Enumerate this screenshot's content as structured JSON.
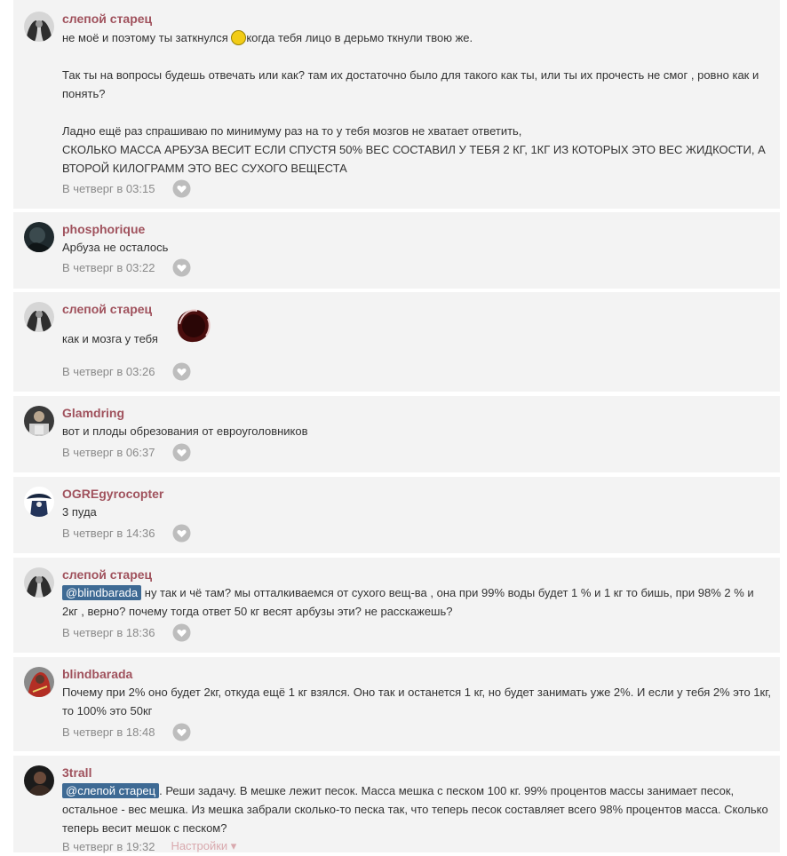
{
  "comments": [
    {
      "author": "слепой старец",
      "lines": [
        "не моё и поэтому ты заткнулся ",
        "когда тебя лицо в дерьмо ткнули твою же.",
        "Так ты на вопросы будешь отвечать или как? там их достаточно было для такого как ты, или ты их прочесть не смог , ровно как и понять?",
        "Ладно ещё раз спрашиваю по минимуму раз на то у тебя мозгов не хватает ответить,",
        "СКОЛЬКО МАССА АРБУЗА ВЕСИТ ЕСЛИ СПУСТЯ 50% ВЕС СОСТАВИЛ У ТЕБЯ 2 КГ, 1КГ ИЗ КОТОРЫХ ЭТО ВЕС ЖИДКОСТИ, А ВТОРОЙ КИЛОГРАММ ЭТО ВЕС СУХОГО ВЕЩЕСТА"
      ],
      "time": "В четверг в 03:15"
    },
    {
      "author": "phosphorique",
      "text": "Арбуза не осталось",
      "time": "В четверг в 03:22"
    },
    {
      "author": "слепой старец",
      "text": "как и мозга у тебя",
      "time": "В четверг в 03:26"
    },
    {
      "author": "Glamdring",
      "text": "вот и плоды обрезования от евроуголовников",
      "time": "В четверг в 06:37"
    },
    {
      "author": "OGREgyrocopter",
      "text": "3 пуда",
      "time": "В четверг в 14:36"
    },
    {
      "author": "слепой старец",
      "mention": "@blindbarada",
      "text": " ну так и чё там? мы отталкиваемся от сухого вещ-ва , она при 99% воды будет 1 % и 1 кг то бишь, при 98%  2 % и 2кг , верно? почему тогда ответ 50 кг весят арбузы эти? не расскажешь?",
      "time": "В четверг в 18:36"
    },
    {
      "author": "blindbarada",
      "text": "Почему при 2% оно будет 2кг, откуда ещё 1 кг взялся. Оно так и останется 1 кг, но будет занимать уже 2%. И если у тебя 2% это 1кг, то 100% это 50кг",
      "time": "В четверг в 18:48"
    },
    {
      "author": "3trall",
      "mention": "@слепой старец",
      "text": ". Реши задачу. В мешке лежит песок. Масса мешка с песком 100 кг. 99% процентов массы занимает песок, остальное - вес мешка. Из мешка забрали сколько-то песка так, что теперь песок составляет всего 98% процентов масса. Сколько теперь весит мешок с песком?",
      "time": "В четверг в 19:32",
      "settings": "Настройки ▾"
    }
  ],
  "icons": {
    "like": "heart-icon",
    "emoji": "smiley-icon"
  },
  "colors": {
    "author": "#a0525d",
    "mention_bg": "#3e6a94",
    "card_bg": "#f3f3f3",
    "meta": "#8a8a8a"
  }
}
